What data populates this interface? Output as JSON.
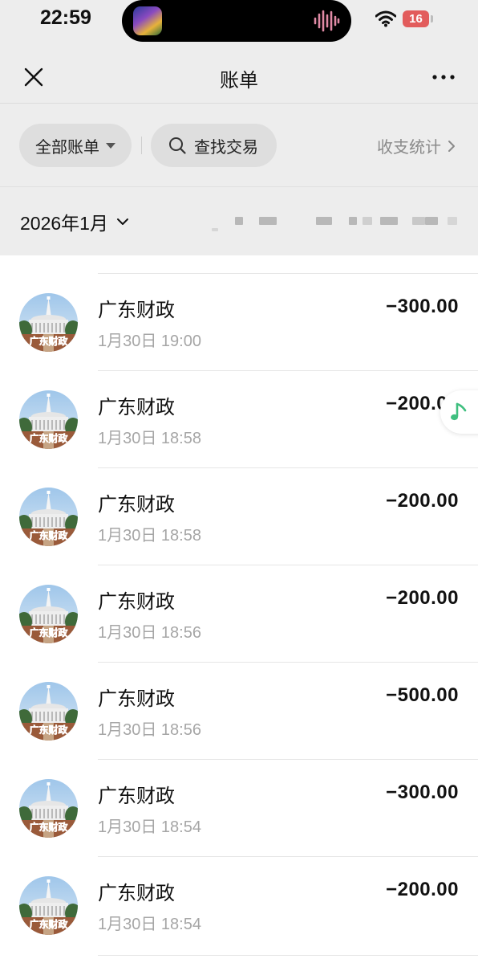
{
  "status_bar": {
    "time": "22:59",
    "battery": "16",
    "island_icons": [
      "album-art-icon",
      "audio-wave-icon"
    ],
    "battery_color": "#e25c5c"
  },
  "nav": {
    "title": "账单",
    "close_icon": "close-icon",
    "more_icon": "more-icon"
  },
  "filters": {
    "all_bills": "全部账单",
    "search": "查找交易",
    "stats": "收支统计"
  },
  "month": {
    "label": "2026年1月"
  },
  "transactions": [
    {
      "merchant": "广东财政",
      "time": "1月30日 19:00",
      "amount": "−300.00"
    },
    {
      "merchant": "广东财政",
      "time": "1月30日 18:58",
      "amount": "−200.00"
    },
    {
      "merchant": "广东财政",
      "time": "1月30日 18:58",
      "amount": "−200.00"
    },
    {
      "merchant": "广东财政",
      "time": "1月30日 18:56",
      "amount": "−200.00"
    },
    {
      "merchant": "广东财政",
      "time": "1月30日 18:56",
      "amount": "−500.00"
    },
    {
      "merchant": "广东财政",
      "time": "1月30日 18:54",
      "amount": "−300.00"
    },
    {
      "merchant": "广东财政",
      "time": "1月30日 18:54",
      "amount": "−200.00"
    }
  ],
  "avatar": {
    "icon": "merchant-logo-icon",
    "logo_text": "广东财政"
  },
  "floating_music": {
    "icon": "music-note-icon",
    "color": "#3fbf7f"
  }
}
